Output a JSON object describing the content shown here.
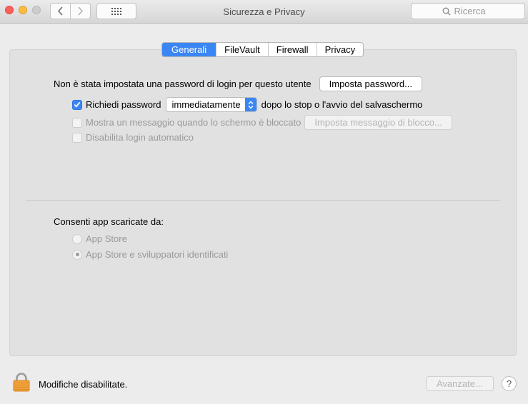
{
  "window": {
    "title": "Sicurezza e Privacy"
  },
  "search": {
    "placeholder": "Ricerca"
  },
  "tabs": [
    {
      "label": "Generali",
      "active": true
    },
    {
      "label": "FileVault",
      "active": false
    },
    {
      "label": "Firewall",
      "active": false
    },
    {
      "label": "Privacy",
      "active": false
    }
  ],
  "general": {
    "no_password_text": "Non è stata impostata una password di login per questo utente",
    "set_password_button": "Imposta password...",
    "require_password": {
      "label": "Richiedi password",
      "checked": true
    },
    "require_password_select": {
      "value": "immediatamente"
    },
    "require_password_suffix": "dopo lo stop o l'avvio del salvaschermo",
    "show_message": {
      "label": "Mostra un messaggio quando lo schermo è bloccato",
      "checked": false
    },
    "set_message_button": "Imposta messaggio di blocco...",
    "disable_autologin": {
      "label": "Disabilita login automatico",
      "checked": false
    }
  },
  "apps": {
    "heading": "Consenti app scaricate da:",
    "options": [
      {
        "label": "App Store",
        "selected": false
      },
      {
        "label": "App Store e sviluppatori identificati",
        "selected": true
      }
    ]
  },
  "footer": {
    "lock_text": "Modifiche disabilitate.",
    "advanced_button": "Avanzate...",
    "help_label": "?"
  },
  "colors": {
    "accent": "#3b86f5",
    "panel": "#e1e1e1",
    "window": "#ececec"
  }
}
